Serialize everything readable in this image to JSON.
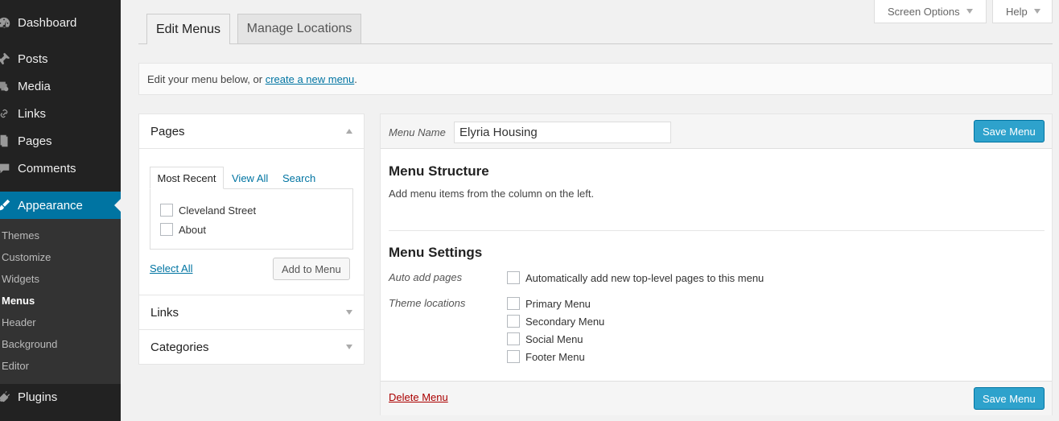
{
  "sidebar": {
    "items": [
      {
        "label": "Dashboard",
        "icon": "dashboard-icon"
      },
      {
        "label": "Posts",
        "icon": "pin-icon"
      },
      {
        "label": "Media",
        "icon": "media-icon"
      },
      {
        "label": "Links",
        "icon": "link-icon"
      },
      {
        "label": "Pages",
        "icon": "pages-icon"
      },
      {
        "label": "Comments",
        "icon": "comment-icon"
      },
      {
        "label": "Appearance",
        "icon": "paintbrush-icon"
      },
      {
        "label": "Plugins",
        "icon": "plugin-icon"
      }
    ],
    "submenu": [
      "Themes",
      "Customize",
      "Widgets",
      "Menus",
      "Header",
      "Background",
      "Editor"
    ],
    "accent_color": "#0074a2"
  },
  "top_buttons": {
    "screen_options": "Screen Options",
    "help": "Help"
  },
  "tabs": {
    "edit_menus": "Edit Menus",
    "manage_locations": "Manage Locations"
  },
  "notice": {
    "text_before": "Edit your menu below, or ",
    "link": "create a new menu",
    "text_after": "."
  },
  "left_panel": {
    "pages": {
      "title": "Pages",
      "tabs": [
        "Most Recent",
        "View All",
        "Search"
      ],
      "items": [
        "Cleveland Street",
        "About"
      ],
      "select_all": "Select All",
      "add_button": "Add to Menu"
    },
    "links_title": "Links",
    "categories_title": "Categories"
  },
  "menu": {
    "name_label": "Menu Name",
    "name_value": "Elyria Housing",
    "save_label": "Save Menu",
    "structure_title": "Menu Structure",
    "structure_desc": "Add menu items from the column on the left.",
    "settings_title": "Menu Settings",
    "auto_add_label": "Auto add pages",
    "auto_add_option": "Automatically add new top-level pages to this menu",
    "theme_locations_label": "Theme locations",
    "locations": [
      "Primary Menu",
      "Secondary Menu",
      "Social Menu",
      "Footer Menu"
    ],
    "delete_label": "Delete Menu"
  }
}
